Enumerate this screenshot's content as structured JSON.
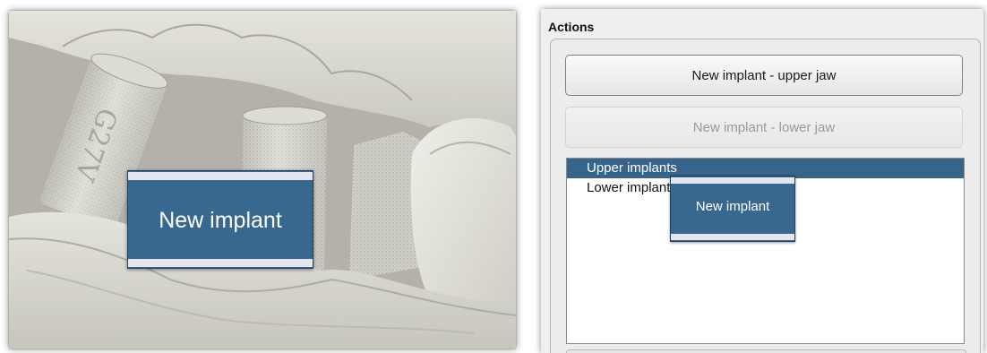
{
  "viewport": {
    "drag_tile_label": "New implant",
    "colors": {
      "scan_surface": "#d9d8d0",
      "background_gap": "#b8b6ae",
      "tile": "#38688f"
    }
  },
  "actions": {
    "title": "Actions",
    "buttons": {
      "upper_jaw": "New implant - upper jaw",
      "lower_jaw": "New implant - lower jaw"
    },
    "list": {
      "items": [
        {
          "label": "Upper implants",
          "selected": true
        },
        {
          "label": "Lower implants",
          "selected": false
        }
      ]
    },
    "drag_tile_label": "New implant",
    "colors": {
      "selection": "#36648b",
      "panel": "#efefef"
    }
  }
}
